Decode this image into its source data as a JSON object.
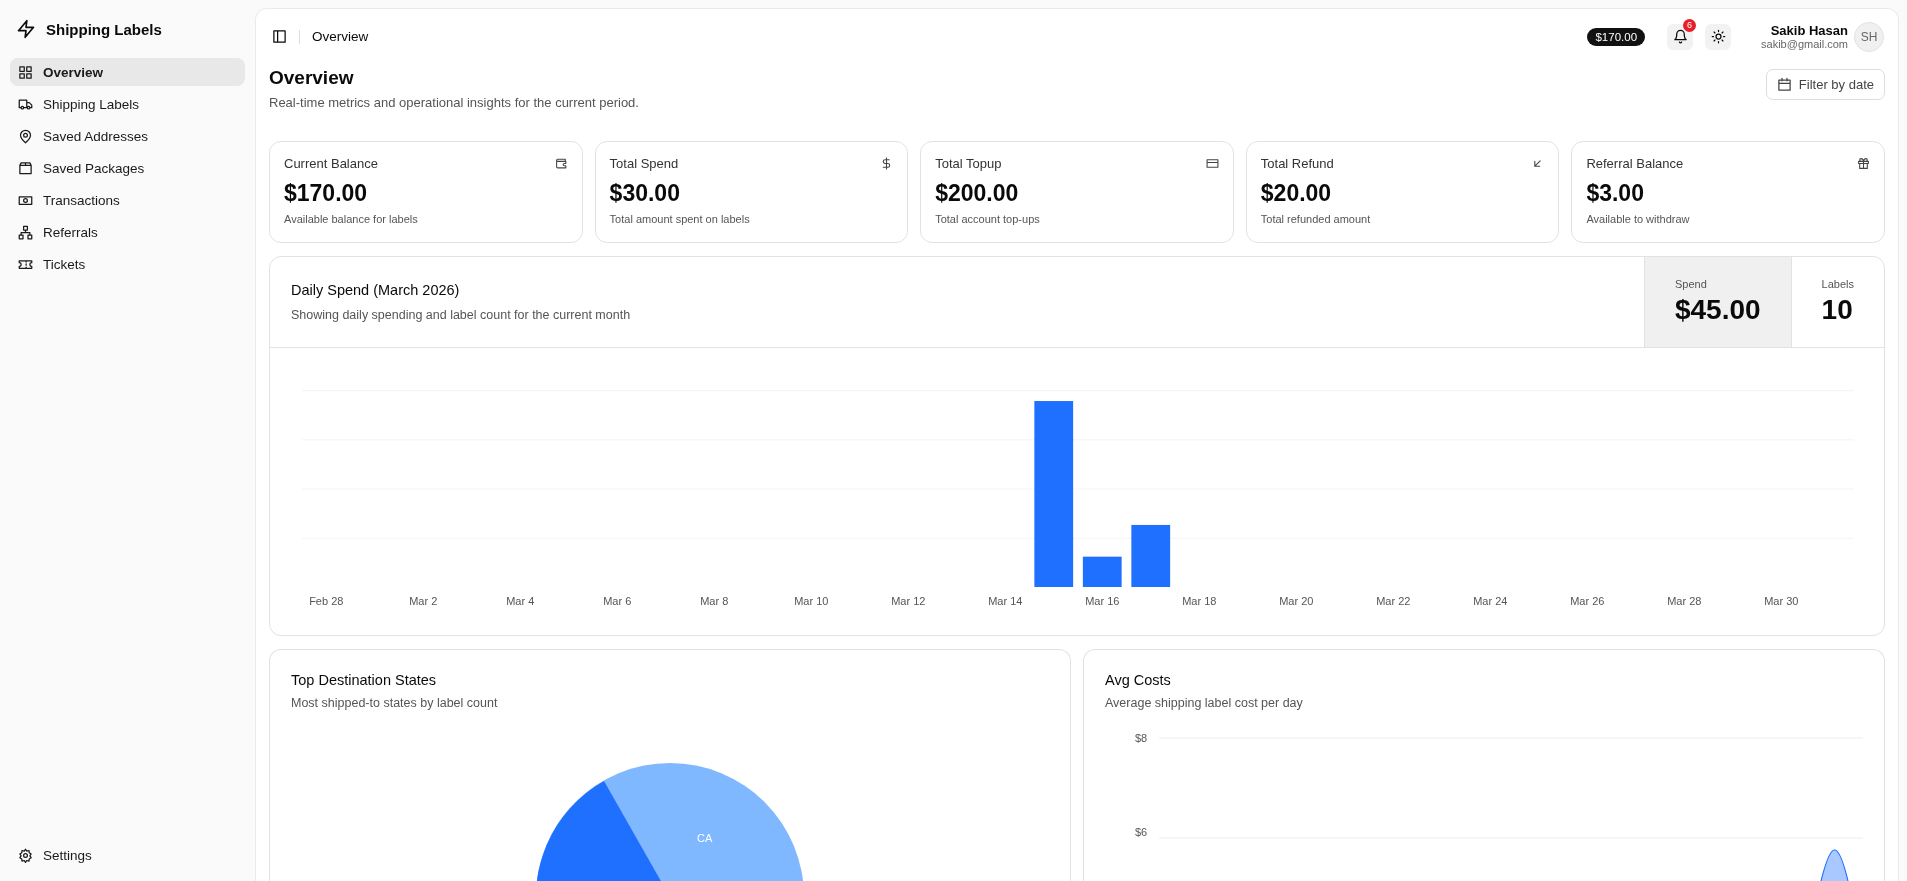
{
  "sidebar": {
    "brand": "Shipping Labels",
    "items": [
      {
        "label": "Overview",
        "selected": true
      },
      {
        "label": "Shipping Labels",
        "selected": false
      },
      {
        "label": "Saved Addresses",
        "selected": false
      },
      {
        "label": "Saved Packages",
        "selected": false
      },
      {
        "label": "Transactions",
        "selected": false
      },
      {
        "label": "Referrals",
        "selected": false
      },
      {
        "label": "Tickets",
        "selected": false
      }
    ],
    "footer_items": [
      {
        "label": "Settings",
        "selected": false
      }
    ]
  },
  "topbar": {
    "breadcrumb": "Overview",
    "balance": "$170.00",
    "notification_count": "6",
    "user_name": "Sakib Hasan",
    "user_email": "sakib@gmail.com",
    "avatar_initials": "SH"
  },
  "page": {
    "title": "Overview",
    "subtitle": "Real-time metrics and operational insights for the current period.",
    "filter_button": "Filter by date"
  },
  "stats": [
    {
      "title": "Current Balance",
      "value": "$170.00",
      "caption": "Available balance for labels"
    },
    {
      "title": "Total Spend",
      "value": "$30.00",
      "caption": "Total amount spent on labels"
    },
    {
      "title": "Total Topup",
      "value": "$200.00",
      "caption": "Total account top-ups"
    },
    {
      "title": "Total Refund",
      "value": "$20.00",
      "caption": "Total refunded amount"
    },
    {
      "title": "Referral Balance",
      "value": "$3.00",
      "caption": "Available to withdraw"
    }
  ],
  "daily_spend": {
    "title": "Daily Spend (March 2026)",
    "subtitle": "Showing daily spending and label count for the current month",
    "metrics": [
      {
        "label": "Spend",
        "value": "$45.00",
        "selected": true
      },
      {
        "label": "Labels",
        "value": "10",
        "selected": false
      }
    ],
    "x_labels": [
      "Feb 28",
      "Mar 2",
      "Mar 4",
      "Mar 6",
      "Mar 8",
      "Mar 10",
      "Mar 12",
      "Mar 14",
      "Mar 16",
      "Mar 18",
      "Mar 20",
      "Mar 22",
      "Mar 24",
      "Mar 26",
      "Mar 28",
      "Mar 30"
    ]
  },
  "top_states": {
    "title": "Top Destination States",
    "subtitle": "Most shipped-to states by label count",
    "slice_labels": [
      "CA"
    ]
  },
  "avg_costs": {
    "title": "Avg Costs",
    "subtitle": "Average shipping label cost per day",
    "y_labels": [
      "$8",
      "$6"
    ]
  }
}
